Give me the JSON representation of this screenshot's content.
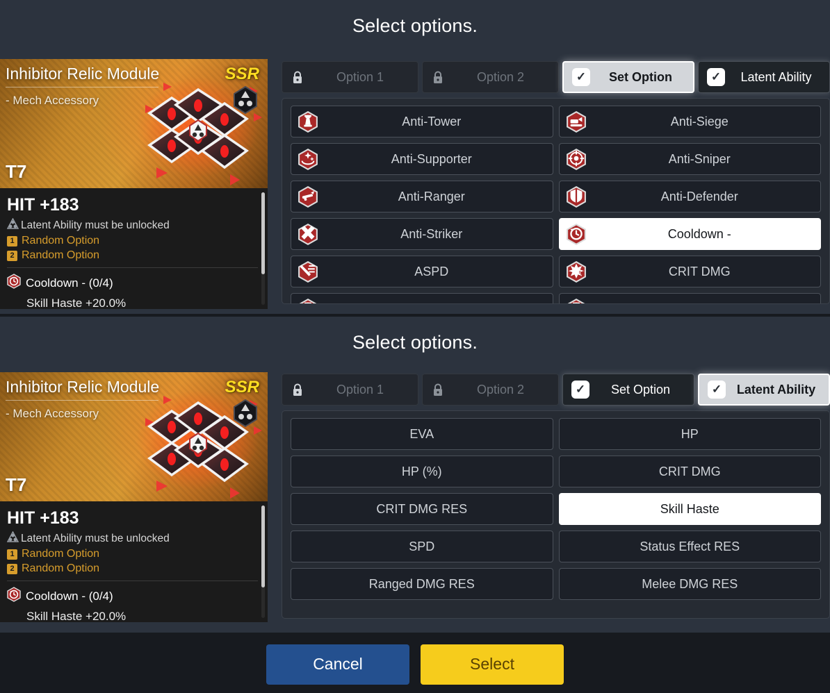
{
  "panels": [
    {
      "title": "Select options.",
      "card": {
        "name": "Inhibitor Relic Module",
        "subtitle": "- Mech Accessory",
        "grade": "SSR",
        "tier": "T7",
        "main_stat": "HIT +183",
        "latent_locked_text": "Latent Ability must be unlocked",
        "random_options": [
          {
            "num": "1",
            "label": "Random Option"
          },
          {
            "num": "2",
            "label": "Random Option"
          }
        ],
        "set_stat": "Cooldown - (0/4)",
        "clipped_stat": "Skill Haste +20.0%",
        "icons": {
          "latent": "triangle-nodes-icon",
          "set": "cooldown-icon",
          "scroll": "scrollbar"
        }
      },
      "tabs": [
        {
          "label": "Option 1",
          "state": "locked",
          "icon": "lock-icon"
        },
        {
          "label": "Option 2",
          "state": "locked",
          "icon": "lock-icon"
        },
        {
          "label": "Set Option",
          "state": "active",
          "icon": "check-icon"
        },
        {
          "label": "Latent Ability",
          "state": "dark",
          "icon": "check-icon"
        }
      ],
      "options": [
        {
          "label": "Anti-Tower",
          "icon": "tower-icon",
          "selected": false
        },
        {
          "label": "Anti-Siege",
          "icon": "siege-icon",
          "selected": false
        },
        {
          "label": "Anti-Supporter",
          "icon": "supporter-icon",
          "selected": false
        },
        {
          "label": "Anti-Sniper",
          "icon": "sniper-icon",
          "selected": false
        },
        {
          "label": "Anti-Ranger",
          "icon": "ranger-icon",
          "selected": false
        },
        {
          "label": "Anti-Defender",
          "icon": "defender-icon",
          "selected": false
        },
        {
          "label": "Anti-Striker",
          "icon": "striker-icon",
          "selected": false
        },
        {
          "label": "Cooldown -",
          "icon": "cooldown-icon",
          "selected": true
        },
        {
          "label": "ASPD",
          "icon": "aspd-icon",
          "selected": false
        },
        {
          "label": "CRIT DMG",
          "icon": "critdmg-icon",
          "selected": false
        }
      ],
      "has_clipped_row": true
    },
    {
      "title": "Select options.",
      "card": {
        "name": "Inhibitor Relic Module",
        "subtitle": "- Mech Accessory",
        "grade": "SSR",
        "tier": "T7",
        "main_stat": "HIT +183",
        "latent_locked_text": "Latent Ability must be unlocked",
        "random_options": [
          {
            "num": "1",
            "label": "Random Option"
          },
          {
            "num": "2",
            "label": "Random Option"
          }
        ],
        "set_stat": "Cooldown - (0/4)",
        "clipped_stat": "Skill Haste +20.0%",
        "icons": {
          "latent": "triangle-nodes-icon",
          "set": "cooldown-icon",
          "scroll": "scrollbar"
        }
      },
      "tabs": [
        {
          "label": "Option 1",
          "state": "locked",
          "icon": "lock-icon"
        },
        {
          "label": "Option 2",
          "state": "locked",
          "icon": "lock-icon"
        },
        {
          "label": "Set Option",
          "state": "dark",
          "icon": "check-icon"
        },
        {
          "label": "Latent Ability",
          "state": "active",
          "icon": "check-icon"
        }
      ],
      "options": [
        {
          "label": "EVA",
          "icon": "",
          "selected": false
        },
        {
          "label": "HP",
          "icon": "",
          "selected": false
        },
        {
          "label": "HP (%)",
          "icon": "",
          "selected": false
        },
        {
          "label": "CRIT DMG",
          "icon": "",
          "selected": false
        },
        {
          "label": "CRIT DMG RES",
          "icon": "",
          "selected": false
        },
        {
          "label": "Skill Haste",
          "icon": "",
          "selected": true
        },
        {
          "label": "SPD",
          "icon": "",
          "selected": false
        },
        {
          "label": "Status Effect RES",
          "icon": "",
          "selected": false
        },
        {
          "label": "Ranged DMG RES",
          "icon": "",
          "selected": false
        },
        {
          "label": "Melee DMG RES",
          "icon": "",
          "selected": false
        }
      ],
      "has_clipped_row": false
    }
  ],
  "footer": {
    "cancel_label": "Cancel",
    "select_label": "Select"
  },
  "colors": {
    "background": "#2c333e",
    "footer_bg": "#171a1f",
    "cancel": "#24508f",
    "select": "#f6cc1c",
    "grade": "#ffdd22",
    "random_option": "#d79d2c",
    "selected_option": "#ffffff",
    "badge_red": "#b02a2a"
  }
}
